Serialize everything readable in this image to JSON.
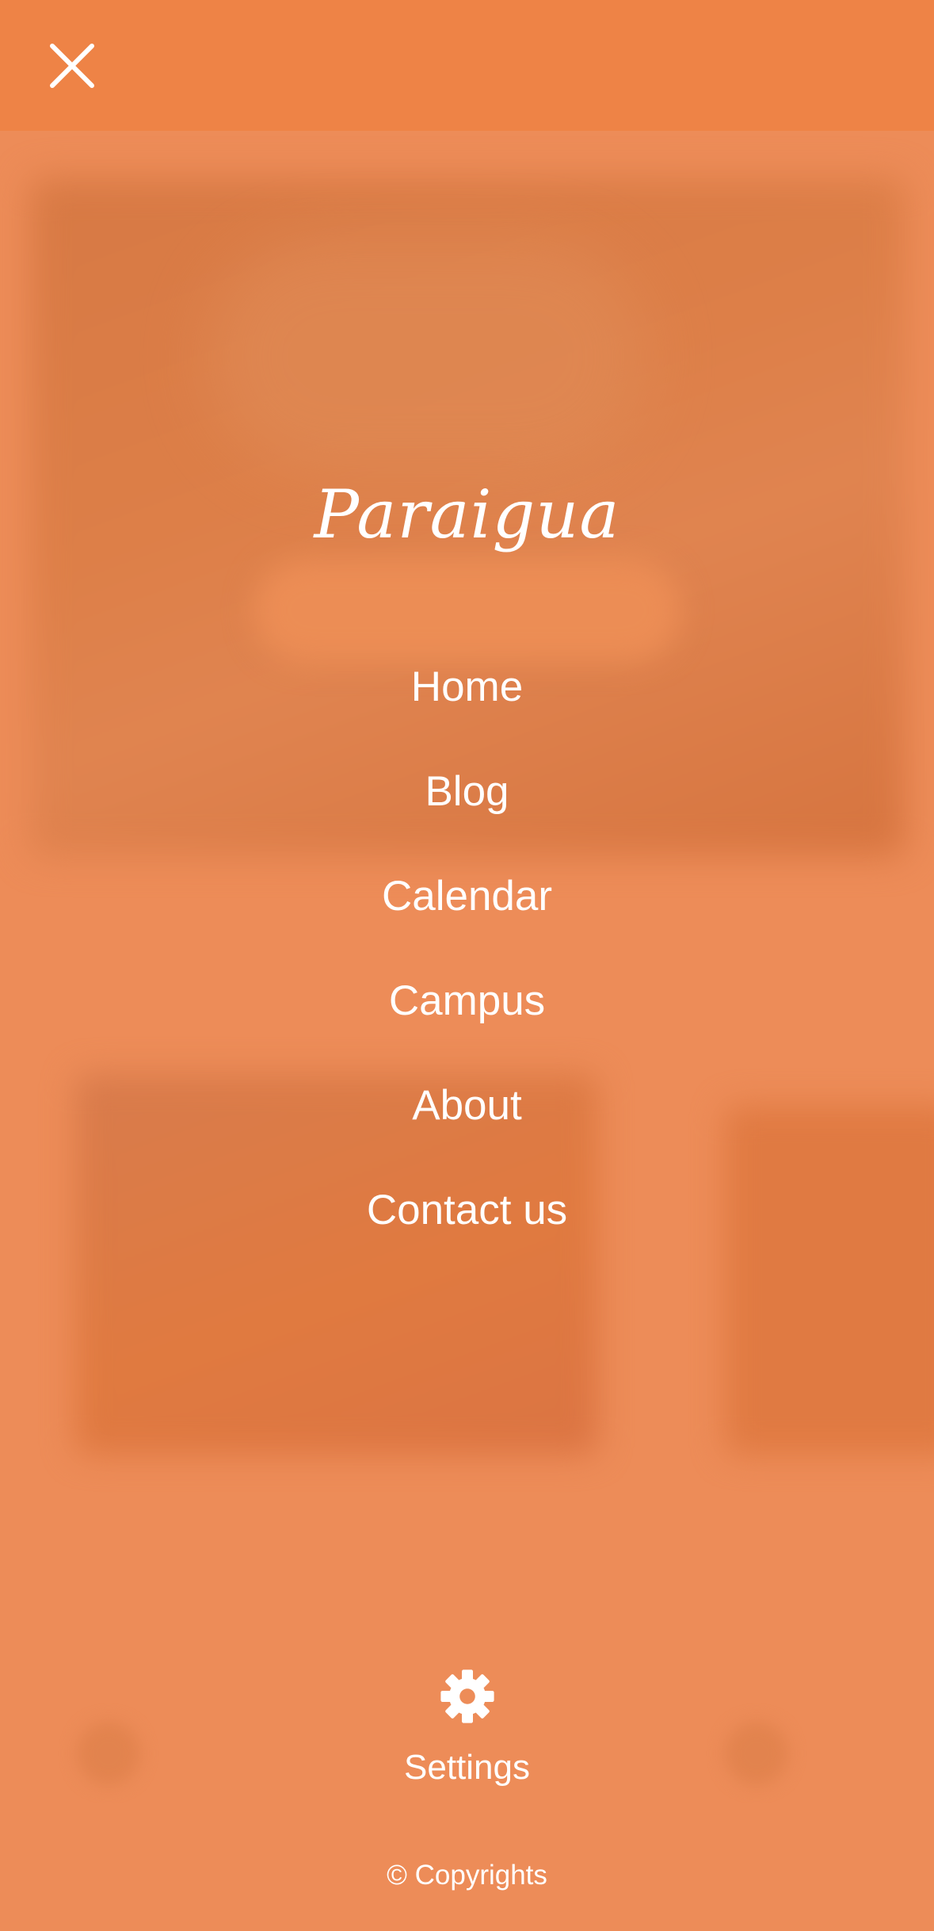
{
  "brand": {
    "name": "Paraigua"
  },
  "close": {
    "icon": "close-icon"
  },
  "menu": {
    "items": [
      {
        "label": "Home"
      },
      {
        "label": "Blog"
      },
      {
        "label": "Calendar"
      },
      {
        "label": "Campus"
      },
      {
        "label": "About"
      },
      {
        "label": "Contact us"
      }
    ]
  },
  "settings": {
    "label": "Settings",
    "icon": "gear-icon"
  },
  "footer": {
    "copyright": "© Copyrights"
  },
  "colors": {
    "overlay": "#ed8c58",
    "text": "#ffffff"
  }
}
